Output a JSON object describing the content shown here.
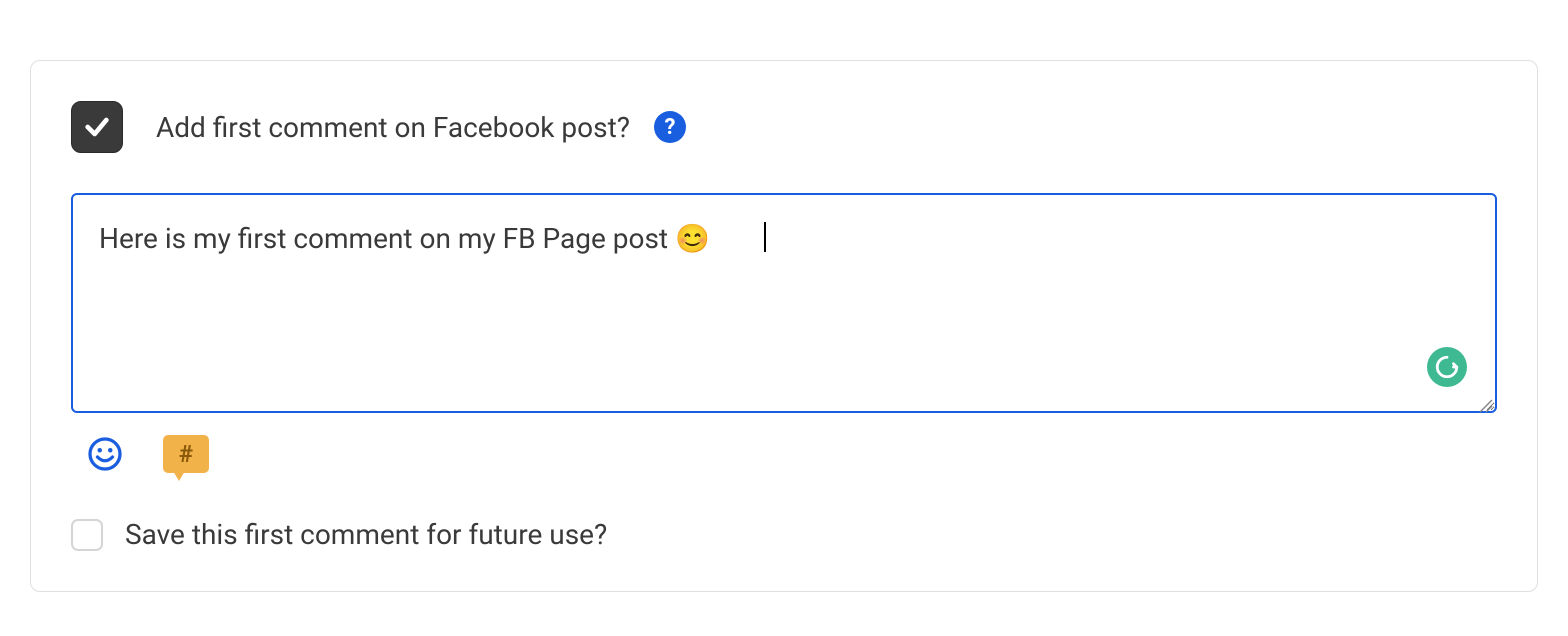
{
  "firstComment": {
    "checkboxChecked": true,
    "label": "Add first comment on Facebook post?",
    "helpSymbol": "?",
    "textareaValue": "Here is my first comment on my FB Page post 😊",
    "hashtagSymbol": "#",
    "saveLabel": "Save this first comment for future use?",
    "saveChecked": false
  }
}
